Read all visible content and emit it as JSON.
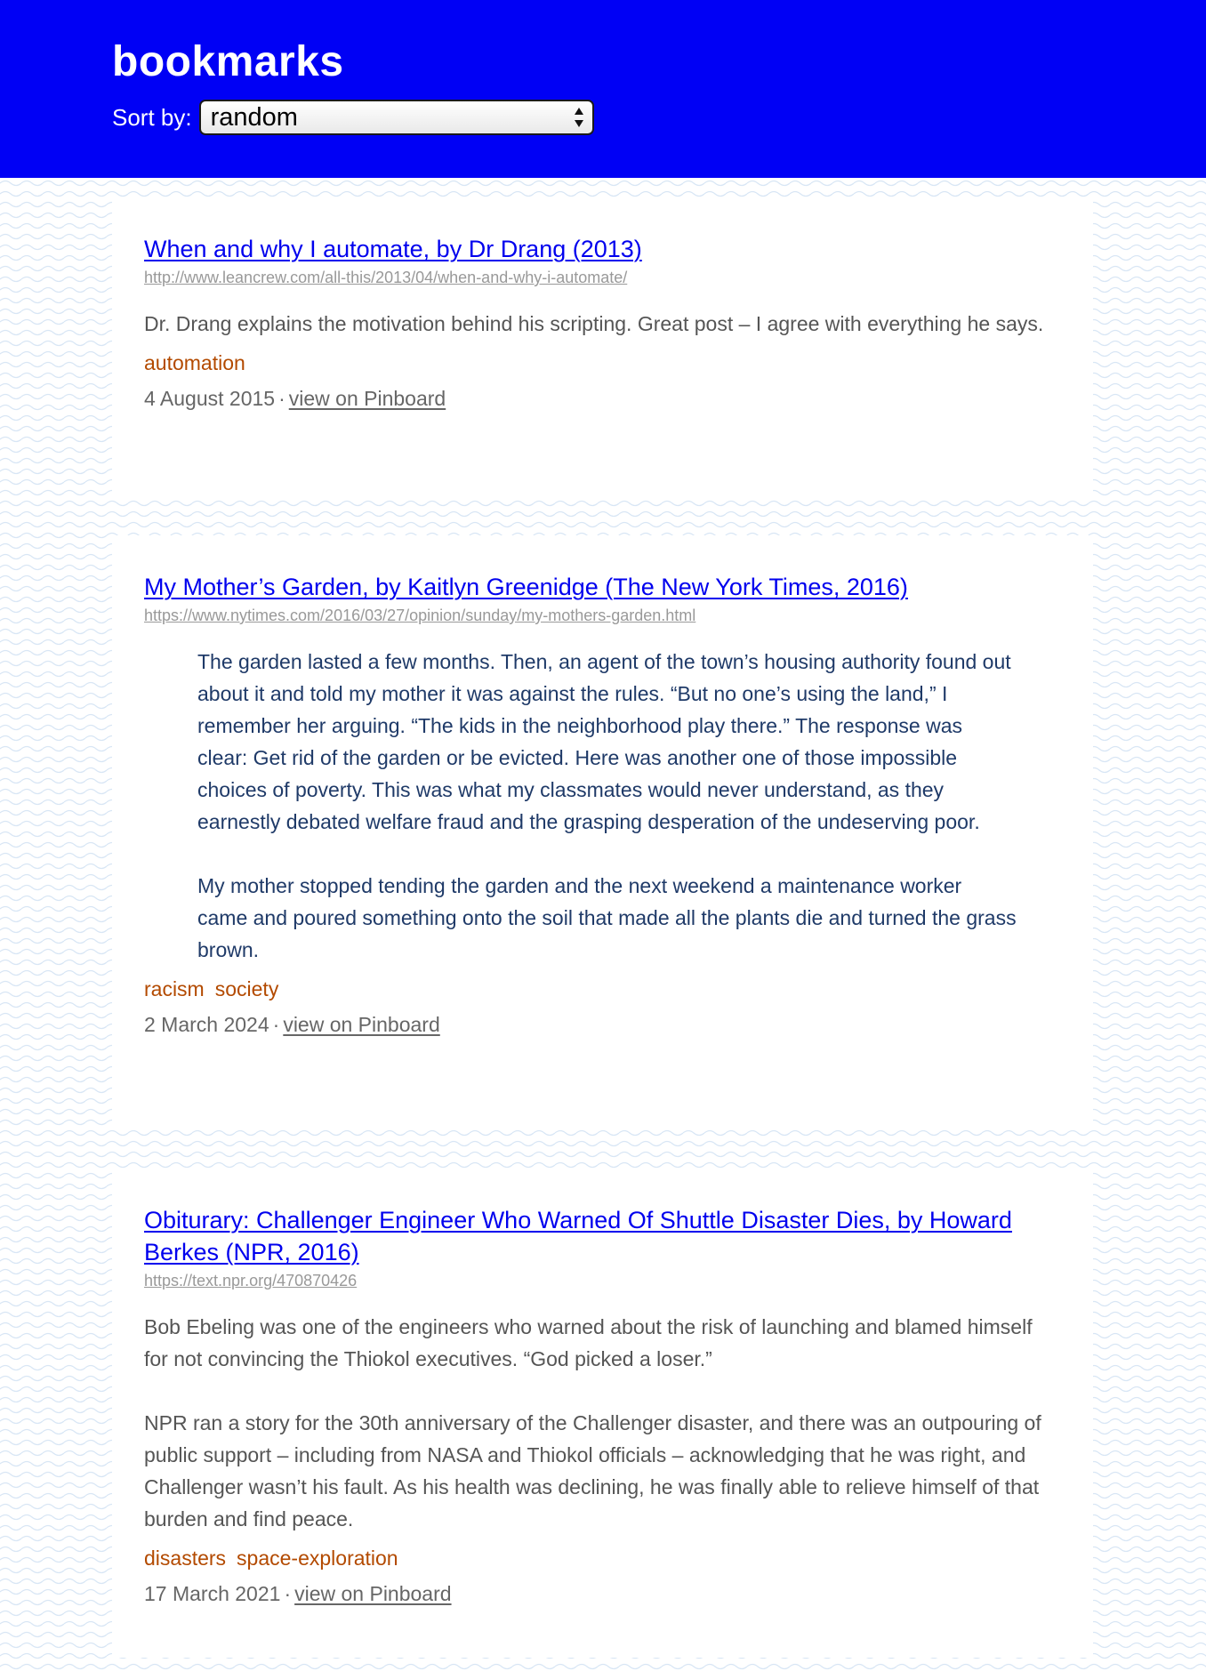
{
  "header": {
    "title": "bookmarks",
    "sort_label": "Sort by:",
    "sort_value": "random"
  },
  "bookmarks": [
    {
      "title": "When and why I automate, by Dr Drang (2013)",
      "url": "http://www.leancrew.com/all-this/2013/04/when-and-why-i-automate/",
      "description": [
        "Dr. Drang explains the motivation behind his scripting. Great post – I agree with everything he says."
      ],
      "quote": [],
      "tags": [
        "automation"
      ],
      "date": "4 August 2015",
      "separator": "·",
      "pinboard_label": "view on Pinboard"
    },
    {
      "title": "My Mother’s Garden, by Kaitlyn Greenidge (The New York Times, 2016)",
      "url": "https://www.nytimes.com/2016/03/27/opinion/sunday/my-mothers-garden.html",
      "description": [],
      "quote": [
        "The garden lasted a few months. Then, an agent of the town’s housing authority found out about it and told my mother it was against the rules. “But no one’s using the land,” I remember her arguing. “The kids in the neighborhood play there.” The response was clear: Get rid of the garden or be evicted. Here was another one of those impossible choices of poverty. This was what my classmates would never understand, as they earnestly debated welfare fraud and the grasping desperation of the undeserving poor.",
        "My mother stopped tending the garden and the next weekend a maintenance worker came and poured something onto the soil that made all the plants die and turned the grass brown."
      ],
      "tags": [
        "racism",
        "society"
      ],
      "date": "2 March 2024",
      "separator": "·",
      "pinboard_label": "view on Pinboard"
    },
    {
      "title": "Obiturary: Challenger Engineer Who Warned Of Shuttle Disaster Dies, by Howard Berkes (NPR, 2016)",
      "url": "https://text.npr.org/470870426",
      "description": [
        "Bob Ebeling was one of the engineers who warned about the risk of launching and blamed himself for not convincing the Thiokol executives. “God picked a loser.”",
        "NPR ran a story for the 30th anniversary of the Challenger disaster, and there was an outpouring of public support – including from NASA and Thiokol officials – acknowledging that he was right, and Challenger wasn’t his fault. As his health was declining, he was finally able to relieve himself of that burden and find peace."
      ],
      "quote": [],
      "tags": [
        "disasters",
        "space-exploration"
      ],
      "date": "17 March 2021",
      "separator": "·",
      "pinboard_label": "view on Pinboard"
    }
  ],
  "colors": {
    "header_bg": "#0000f5",
    "link": "#0000ee",
    "tag": "#b34a00",
    "quote": "#1f3a68",
    "text": "#555555"
  }
}
